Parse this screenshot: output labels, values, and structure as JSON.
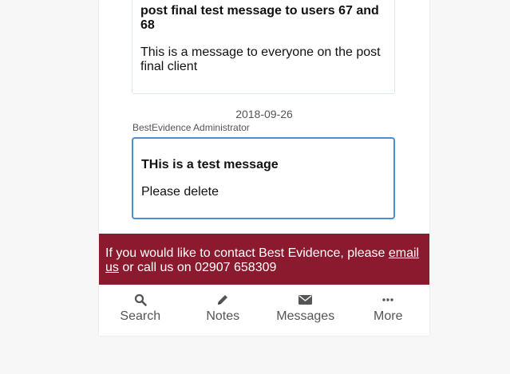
{
  "previous_message": {
    "title": "post final test message to users 67 and 68",
    "body": "This is a message to everyone on the post final client"
  },
  "current_message": {
    "date": "2018-09-26",
    "sender": "BestEvidence Administrator",
    "title": "THis is a test message",
    "body": "Please delete"
  },
  "contact_banner": {
    "text_before": "If you would like to contact Best Evidence, please ",
    "link_text": "email us",
    "text_after": " or call us on 02907 658309",
    "background": "#8c1a2e"
  },
  "bottom_nav": {
    "items": [
      {
        "label": "Search",
        "icon": "search-icon"
      },
      {
        "label": "Notes",
        "icon": "pencil-icon"
      },
      {
        "label": "Messages",
        "icon": "envelope-icon"
      },
      {
        "label": "More",
        "icon": "ellipsis-icon"
      }
    ]
  },
  "colors": {
    "accent_border": "#4a8fd6",
    "banner": "#8c1a2e"
  }
}
